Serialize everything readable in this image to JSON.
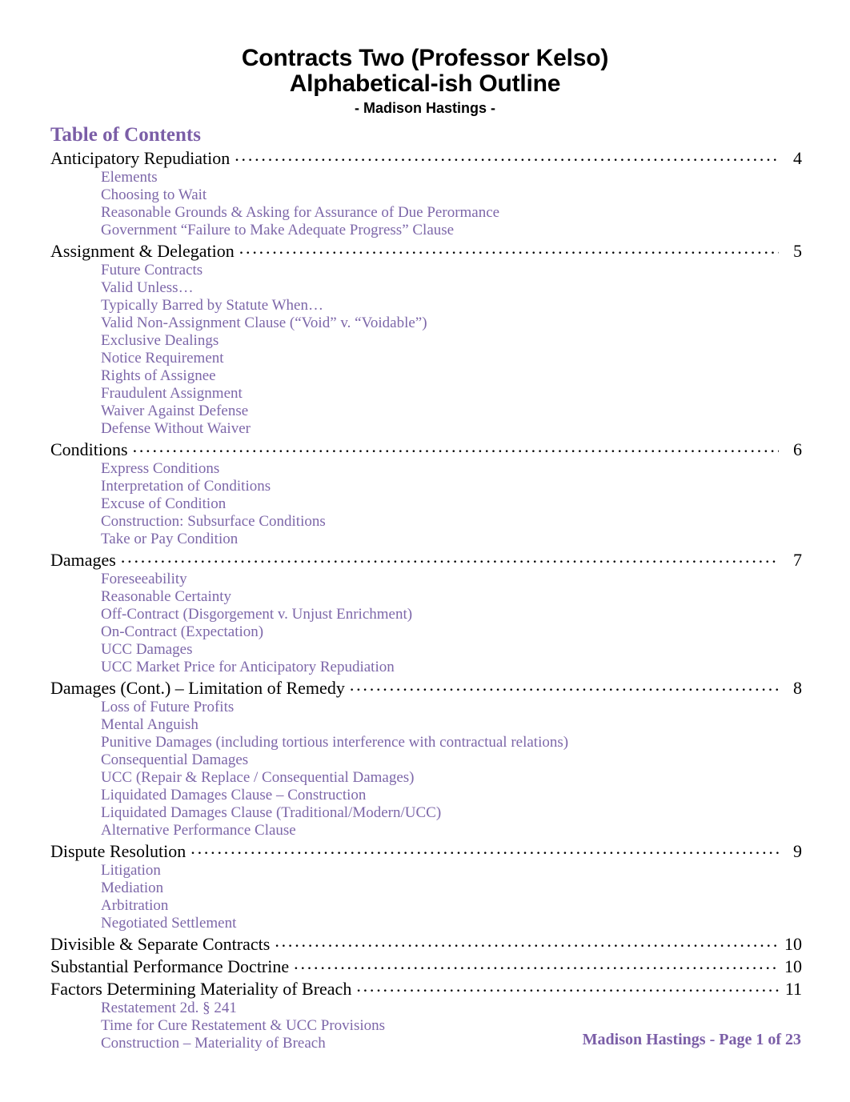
{
  "title": {
    "line1": "Contracts Two (Professor Kelso)",
    "line2": "Alphabetical-ish Outline",
    "author": "- Madison Hastings -"
  },
  "toc": {
    "heading": "Table of Contents",
    "entries": [
      {
        "label": "Anticipatory Repudiation",
        "page": "4",
        "subs": [
          "Elements",
          "Choosing to Wait",
          "Reasonable Grounds & Asking for Assurance of Due Perormance",
          "Government “Failure to Make Adequate Progress” Clause"
        ]
      },
      {
        "label": "Assignment & Delegation",
        "page": "5",
        "subs": [
          "Future Contracts",
          "Valid Unless…",
          "Typically Barred by Statute When…",
          "Valid Non-Assignment Clause (“Void” v. “Voidable”)",
          "Exclusive Dealings",
          "Notice Requirement",
          "Rights of Assignee",
          "Fraudulent Assignment",
          "Waiver Against Defense",
          "Defense Without Waiver"
        ]
      },
      {
        "label": "Conditions",
        "page": "6",
        "subs": [
          "Express Conditions",
          "Interpretation of Conditions",
          "Excuse of Condition",
          "Construction: Subsurface Conditions",
          "Take or Pay Condition"
        ]
      },
      {
        "label": "Damages",
        "page": "7",
        "subs": [
          "Foreseeability",
          "Reasonable Certainty",
          "Off-Contract (Disgorgement v. Unjust Enrichment)",
          "On-Contract (Expectation)",
          "UCC Damages",
          "UCC Market Price for Anticipatory Repudiation"
        ]
      },
      {
        "label": "Damages (Cont.) – Limitation of Remedy",
        "page": "8",
        "subs": [
          "Loss of Future Profits",
          "Mental Anguish",
          "Punitive Damages (including tortious interference with contractual relations)",
          "Consequential Damages",
          "UCC (Repair & Replace / Consequential Damages)",
          "Liquidated Damages Clause – Construction",
          "Liquidated Damages Clause (Traditional/Modern/UCC)",
          "Alternative Performance Clause"
        ]
      },
      {
        "label": "Dispute Resolution",
        "page": "9",
        "subs": [
          "Litigation",
          "Mediation",
          "Arbitration",
          "Negotiated Settlement"
        ]
      },
      {
        "label": "Divisible & Separate Contracts",
        "page": "10",
        "subs": []
      },
      {
        "label": "Substantial Performance Doctrine",
        "page": "10",
        "subs": []
      },
      {
        "label": "Factors Determining Materiality of Breach",
        "page": "11",
        "subs": [
          "Restatement 2d. § 241",
          "Time for Cure Restatement & UCC Provisions",
          "Construction – Materiality of Breach"
        ]
      }
    ]
  },
  "footer": {
    "text": "Madison Hastings - Page 1 of 23"
  },
  "colors": {
    "heading_purple": "#7b5ea7",
    "sub_purple": "#7d67a9",
    "body_black": "#000000"
  }
}
